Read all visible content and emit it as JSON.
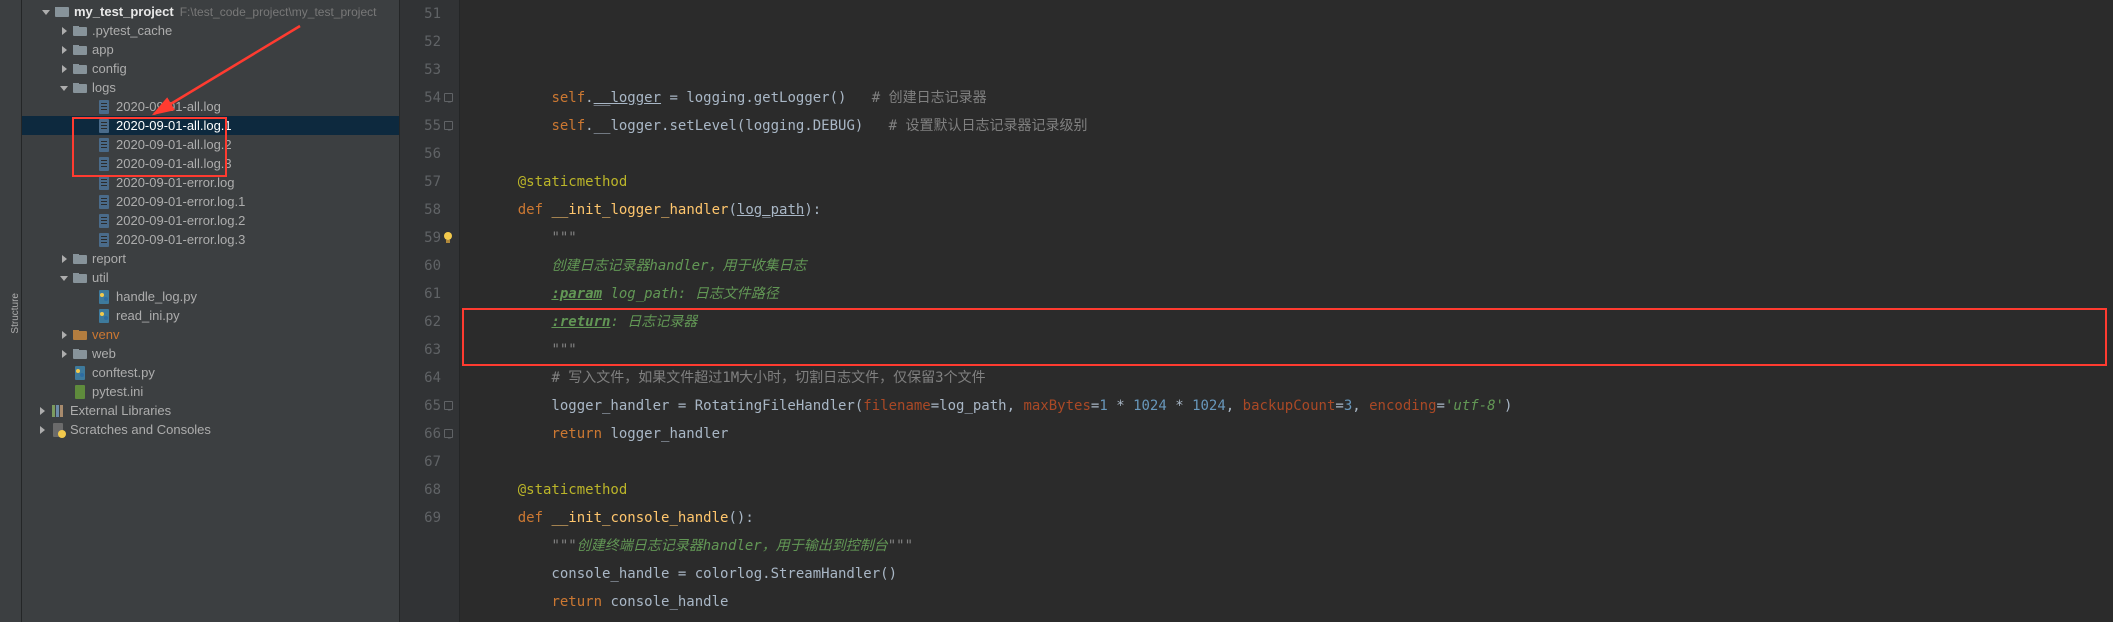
{
  "project": {
    "name": "my_test_project",
    "path": "F:\\test_code_project\\my_test_project"
  },
  "tree": {
    "items": [
      {
        "indent": 18,
        "arrow": "down",
        "icon": "folder-root",
        "label": "my_test_project",
        "bold": true,
        "hint": "F:\\test_code_project\\my_test_project"
      },
      {
        "indent": 36,
        "arrow": "right",
        "icon": "folder",
        "label": ".pytest_cache"
      },
      {
        "indent": 36,
        "arrow": "right",
        "icon": "folder",
        "label": "app"
      },
      {
        "indent": 36,
        "arrow": "right",
        "icon": "folder",
        "label": "config"
      },
      {
        "indent": 36,
        "arrow": "down",
        "icon": "folder",
        "label": "logs"
      },
      {
        "indent": 60,
        "arrow": "",
        "icon": "file-log",
        "label": "2020-09-01-all.log"
      },
      {
        "indent": 60,
        "arrow": "",
        "icon": "file-log",
        "label": "2020-09-01-all.log.1",
        "selected": true
      },
      {
        "indent": 60,
        "arrow": "",
        "icon": "file-log",
        "label": "2020-09-01-all.log.2"
      },
      {
        "indent": 60,
        "arrow": "",
        "icon": "file-log",
        "label": "2020-09-01-all.log.3"
      },
      {
        "indent": 60,
        "arrow": "",
        "icon": "file-log",
        "label": "2020-09-01-error.log"
      },
      {
        "indent": 60,
        "arrow": "",
        "icon": "file-log",
        "label": "2020-09-01-error.log.1"
      },
      {
        "indent": 60,
        "arrow": "",
        "icon": "file-log",
        "label": "2020-09-01-error.log.2"
      },
      {
        "indent": 60,
        "arrow": "",
        "icon": "file-log",
        "label": "2020-09-01-error.log.3"
      },
      {
        "indent": 36,
        "arrow": "right",
        "icon": "folder",
        "label": "report"
      },
      {
        "indent": 36,
        "arrow": "down",
        "icon": "folder",
        "label": "util"
      },
      {
        "indent": 60,
        "arrow": "",
        "icon": "file-py",
        "label": "handle_log.py"
      },
      {
        "indent": 60,
        "arrow": "",
        "icon": "file-py",
        "label": "read_ini.py"
      },
      {
        "indent": 36,
        "arrow": "right",
        "icon": "folder-venv",
        "label": "venv",
        "venv": true
      },
      {
        "indent": 36,
        "arrow": "right",
        "icon": "folder",
        "label": "web"
      },
      {
        "indent": 36,
        "arrow": "",
        "icon": "file-py",
        "label": "conftest.py"
      },
      {
        "indent": 36,
        "arrow": "",
        "icon": "file-ini",
        "label": "pytest.ini"
      },
      {
        "indent": 14,
        "arrow": "right",
        "icon": "lib",
        "label": "External Libraries"
      },
      {
        "indent": 14,
        "arrow": "right",
        "icon": "scratch",
        "label": "Scratches and Consoles"
      }
    ]
  },
  "editor": {
    "first_line_no": 51,
    "lines": [
      {
        "n": 51,
        "seg": [
          [
            "",
            "        "
          ],
          [
            "kw",
            "self"
          ],
          [
            "",
            "."
          ],
          [
            "und",
            "__logger"
          ],
          [
            "",
            " = logging.getLogger()   "
          ],
          [
            "cmt",
            "# 创建日志记录器"
          ]
        ]
      },
      {
        "n": 52,
        "seg": [
          [
            "",
            "        "
          ],
          [
            "kw",
            "self"
          ],
          [
            "",
            ".__logger.setLevel(logging.DEBUG)   "
          ],
          [
            "cmt",
            "# 设置默认日志记录器记录级别"
          ]
        ]
      },
      {
        "n": 53,
        "seg": [
          [
            "",
            ""
          ]
        ]
      },
      {
        "n": 54,
        "seg": [
          [
            "",
            "    "
          ],
          [
            "dec",
            "@staticmethod"
          ]
        ],
        "fold": true
      },
      {
        "n": 55,
        "seg": [
          [
            "",
            "    "
          ],
          [
            "kw",
            "def"
          ],
          [
            "",
            " "
          ],
          [
            "fn",
            "__init_logger_handler"
          ],
          [
            "",
            "("
          ],
          [
            "und",
            "log_path"
          ],
          [
            "",
            "):"
          ]
        ],
        "fold": true
      },
      {
        "n": 56,
        "seg": [
          [
            "",
            "        "
          ],
          [
            "str",
            "\"\"\""
          ]
        ]
      },
      {
        "n": 57,
        "seg": [
          [
            "",
            "        "
          ],
          [
            "doc",
            "创建日志记录器handler，用于收集日志"
          ]
        ]
      },
      {
        "n": 58,
        "seg": [
          [
            "",
            "        "
          ],
          [
            "doctag",
            ":param"
          ],
          [
            "doc",
            " log_path: 日志文件路径"
          ]
        ]
      },
      {
        "n": 59,
        "seg": [
          [
            "",
            "        "
          ],
          [
            "doctag",
            ":return"
          ],
          [
            "doc",
            ": 日志记录器"
          ]
        ],
        "bulb": true
      },
      {
        "n": 60,
        "seg": [
          [
            "",
            "        "
          ],
          [
            "str",
            "\"\"\""
          ]
        ]
      },
      {
        "n": 61,
        "seg": [
          [
            "",
            "        "
          ],
          [
            "cmt",
            "# 写入文件，如果文件超过1M大小时，切割日志文件，仅保留3个文件"
          ]
        ]
      },
      {
        "n": 62,
        "seg": [
          [
            "",
            "        logger_handler = RotatingFileHandler("
          ],
          [
            "par",
            "filename"
          ],
          [
            "",
            "=log_path, "
          ],
          [
            "par",
            "maxBytes"
          ],
          [
            "",
            "="
          ],
          [
            "num",
            "1"
          ],
          [
            "",
            " * "
          ],
          [
            "num",
            "1024"
          ],
          [
            "",
            " * "
          ],
          [
            "num",
            "1024"
          ],
          [
            "",
            ", "
          ],
          [
            "par",
            "backupCount"
          ],
          [
            "",
            "="
          ],
          [
            "num",
            "3"
          ],
          [
            "",
            ", "
          ],
          [
            "par",
            "encoding"
          ],
          [
            "",
            "="
          ],
          [
            "doc",
            "'utf-8'"
          ],
          [
            "",
            ")"
          ]
        ]
      },
      {
        "n": 63,
        "seg": [
          [
            "",
            "        "
          ],
          [
            "kw",
            "return"
          ],
          [
            "",
            " logger_handler"
          ]
        ]
      },
      {
        "n": 64,
        "seg": [
          [
            "",
            ""
          ]
        ]
      },
      {
        "n": 65,
        "seg": [
          [
            "",
            "    "
          ],
          [
            "dec",
            "@staticmethod"
          ]
        ],
        "fold": true
      },
      {
        "n": 66,
        "seg": [
          [
            "",
            "    "
          ],
          [
            "kw",
            "def"
          ],
          [
            "",
            " "
          ],
          [
            "fn",
            "__init_console_handle"
          ],
          [
            "",
            "():"
          ]
        ],
        "fold": true
      },
      {
        "n": 67,
        "seg": [
          [
            "",
            "        "
          ],
          [
            "str",
            "\"\"\""
          ],
          [
            "doc",
            "创建终端日志记录器handler，用于输出到控制台"
          ],
          [
            "str",
            "\"\"\""
          ]
        ]
      },
      {
        "n": 68,
        "seg": [
          [
            "",
            "        console_handle = colorlog.StreamHandler()"
          ]
        ]
      },
      {
        "n": 69,
        "seg": [
          [
            "",
            "        "
          ],
          [
            "kw",
            "return"
          ],
          [
            "",
            " console_handle"
          ]
        ]
      }
    ]
  }
}
